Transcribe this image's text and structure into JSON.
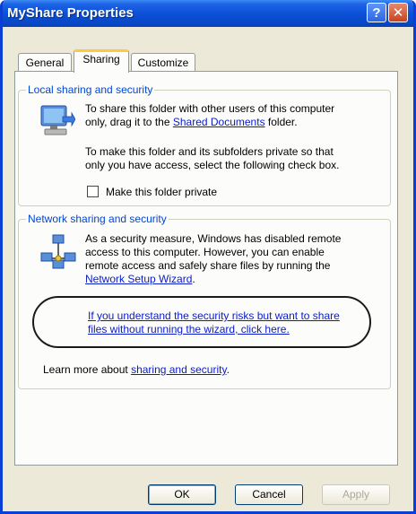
{
  "window": {
    "title": "MyShare Properties"
  },
  "titlebar_buttons": {
    "help": "?",
    "close": "✕"
  },
  "tabs": [
    {
      "label": "General"
    },
    {
      "label": "Sharing"
    },
    {
      "label": "Customize"
    }
  ],
  "local": {
    "label": "Local sharing and security",
    "p1_line1": "To share this folder with other users of this computer",
    "p1_line2_pre": "only, drag it to the ",
    "p1_link": "Shared Documents",
    "p1_line2_post": " folder.",
    "p2_line1": "To make this folder and its subfolders private so that",
    "p2_line2": "only you have access, select the following check box.",
    "checkbox_label": "Make this folder private",
    "checkbox_checked": false
  },
  "network": {
    "label": "Network sharing and security",
    "line1": "As a security measure, Windows has disabled remote",
    "line2": "access to this computer. However, you can enable",
    "line3": "remote access and safely share files by running the",
    "wizard_link": "Network Setup Wizard",
    "wizard_link_suffix": ".",
    "risk_link_line1": "If you understand the security risks but want to share",
    "risk_link_line2": "files without running the wizard, click here.",
    "learn_more_pre": "Learn more about ",
    "learn_more_link": "sharing and security",
    "learn_more_post": "."
  },
  "buttons": {
    "ok": "OK",
    "cancel": "Cancel",
    "apply": "Apply"
  }
}
